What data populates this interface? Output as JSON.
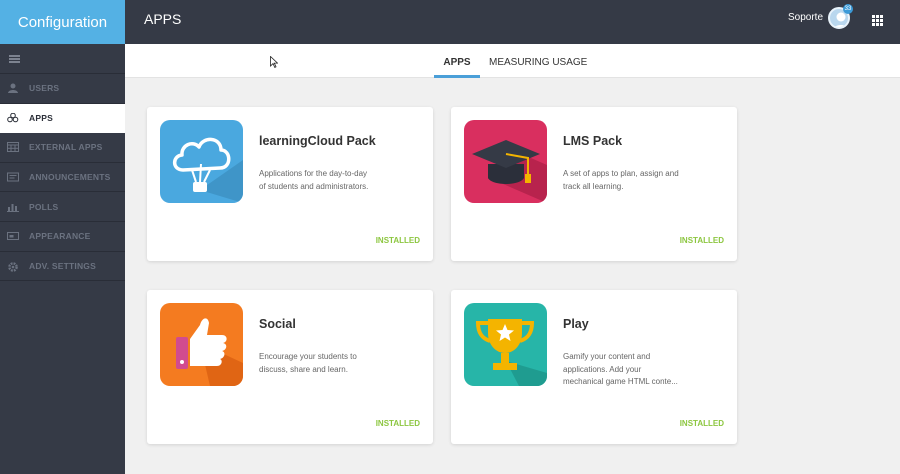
{
  "brand": "Configuration",
  "page_title": "APPS",
  "user": {
    "name": "Soporte",
    "badge": "33"
  },
  "sidebar": {
    "items": [
      {
        "label": "USERS",
        "icon": "user-icon",
        "active": false
      },
      {
        "label": "APPS",
        "icon": "apps-icon",
        "active": true
      },
      {
        "label": "EXTERNAL APPS",
        "icon": "calendar-grid-icon",
        "active": false
      },
      {
        "label": "ANNOUNCEMENTS",
        "icon": "announcement-icon",
        "active": false
      },
      {
        "label": "POLLS",
        "icon": "bar-chart-icon",
        "active": false
      },
      {
        "label": "APPEARANCE",
        "icon": "appearance-icon",
        "active": false
      },
      {
        "label": "ADV. SETTINGS",
        "icon": "gear-icon",
        "active": false
      }
    ]
  },
  "tabs": [
    {
      "label": "APPS",
      "active": true
    },
    {
      "label": "MEASURING USAGE",
      "active": false
    }
  ],
  "cards": [
    {
      "title": "learningCloud Pack",
      "desc1": "Applications for the day-to-day",
      "desc2": "of students and administrators.",
      "desc3": "",
      "status": "INSTALLED",
      "icon": "cloud-balloon-icon",
      "color": "#4aa8df"
    },
    {
      "title": "LMS Pack",
      "desc1": "A set of apps to plan, assign and",
      "desc2": "track all learning.",
      "desc3": "",
      "status": "INSTALLED",
      "icon": "graduation-cap-icon",
      "color": "#d92f5f"
    },
    {
      "title": "Social",
      "desc1": "Encourage your students to",
      "desc2": "discuss, share and learn.",
      "desc3": "",
      "status": "INSTALLED",
      "icon": "thumbs-up-icon",
      "color": "#f47b20"
    },
    {
      "title": "Play",
      "desc1": "Gamify your content and",
      "desc2": "applications. Add your",
      "desc3": "mechanical game HTML conte...",
      "status": "INSTALLED",
      "icon": "trophy-icon",
      "color": "#27b5a8"
    }
  ]
}
